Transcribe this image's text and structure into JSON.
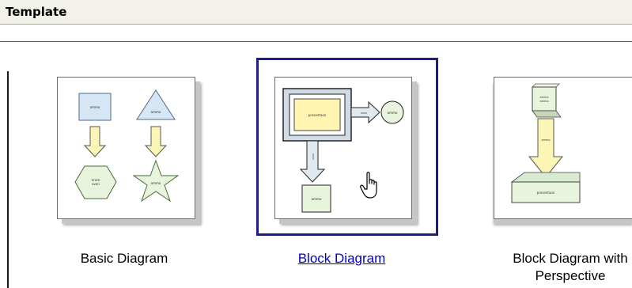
{
  "header": {
    "title": "Template"
  },
  "templates": [
    {
      "label": "Basic Diagram",
      "selected": false
    },
    {
      "label": "Block Diagram",
      "selected": true
    },
    {
      "label": "Block Diagram with Perspective",
      "selected": false
    }
  ],
  "colors": {
    "selection_border": "#1c1c8c",
    "link_text": "#0000cc",
    "shape_blue": "#d7e6f5",
    "shape_green": "#e8f5dc",
    "shape_yellow": "#fff5b0"
  },
  "icons": [
    "hand-pointer-cursor-icon"
  ]
}
